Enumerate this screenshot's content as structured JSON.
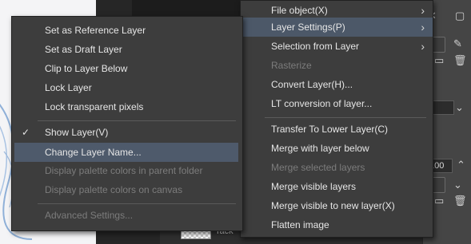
{
  "background": {
    "opacity_value": "100",
    "layer_label": "Tack"
  },
  "context_menu": {
    "items": [
      {
        "label": "Set as Reference Layer",
        "enabled": true
      },
      {
        "label": "Set as Draft Layer",
        "enabled": true
      },
      {
        "label": "Clip to Layer Below",
        "enabled": true
      },
      {
        "label": "Lock Layer",
        "enabled": true
      },
      {
        "label": "Lock transparent pixels",
        "enabled": true
      },
      {
        "label": "Show Layer(V)",
        "enabled": true,
        "checked": true
      },
      {
        "label": "Change Layer Name...",
        "enabled": true,
        "highlighted": true
      },
      {
        "label": "Display palette colors in parent folder",
        "enabled": false
      },
      {
        "label": "Display palette colors on canvas",
        "enabled": false
      },
      {
        "label": "Advanced Settings...",
        "enabled": false
      }
    ]
  },
  "layer_menu": {
    "items": [
      {
        "label": "File object(X)",
        "enabled": true,
        "submenu": true
      },
      {
        "label": "Layer Settings(P)",
        "enabled": true,
        "submenu": true,
        "highlighted": true
      },
      {
        "label": "Selection from Layer",
        "enabled": true,
        "submenu": true
      },
      {
        "label": "Rasterize",
        "enabled": false
      },
      {
        "label": "Convert Layer(H)...",
        "enabled": true
      },
      {
        "label": "LT conversion of layer...",
        "enabled": true
      },
      {
        "label": "Transfer To Lower Layer(C)",
        "enabled": true
      },
      {
        "label": "Merge with layer below",
        "enabled": true
      },
      {
        "label": "Merge selected layers",
        "enabled": false
      },
      {
        "label": "Merge visible layers",
        "enabled": true
      },
      {
        "label": "Merge visible to new layer(X)",
        "enabled": true
      },
      {
        "label": "Flatten image",
        "enabled": true
      }
    ]
  },
  "icons": {
    "check": "✓",
    "submenu_arrow": "›"
  },
  "colors": {
    "menu_bg": "#3d3d3d",
    "highlight": "#4e5a6b",
    "text": "#e6e6e6",
    "disabled_text": "#7c7c7c"
  }
}
